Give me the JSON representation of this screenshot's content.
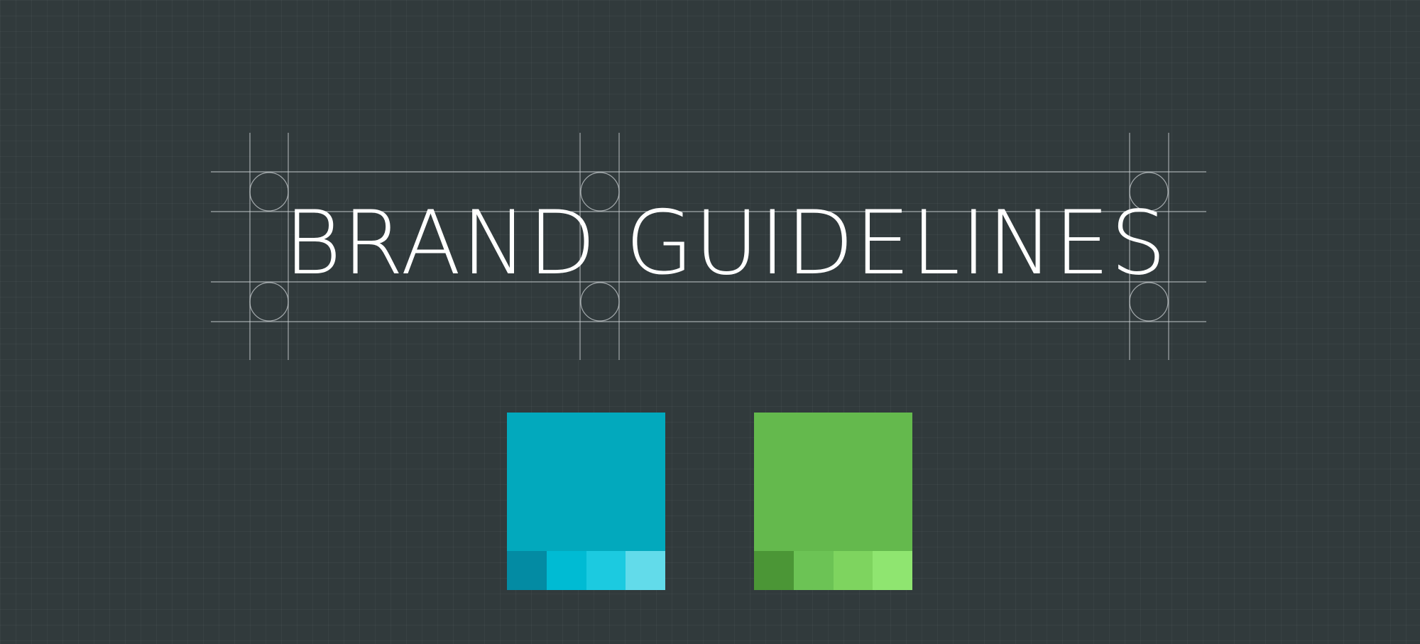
{
  "title": "BRAND GUIDELINES",
  "palette": {
    "primary": {
      "name": "teal",
      "main": "#02a9bd",
      "tints": [
        "#038ba3",
        "#00bbd3",
        "#1ccae0",
        "#62dbea"
      ]
    },
    "secondary": {
      "name": "green",
      "main": "#64b94d",
      "tints": [
        "#4b9636",
        "#6cc355",
        "#7ed45f",
        "#8fe570"
      ]
    }
  },
  "colors": {
    "background": "#313a3c",
    "guides": "#c9cfd1",
    "text": "#ffffff"
  }
}
